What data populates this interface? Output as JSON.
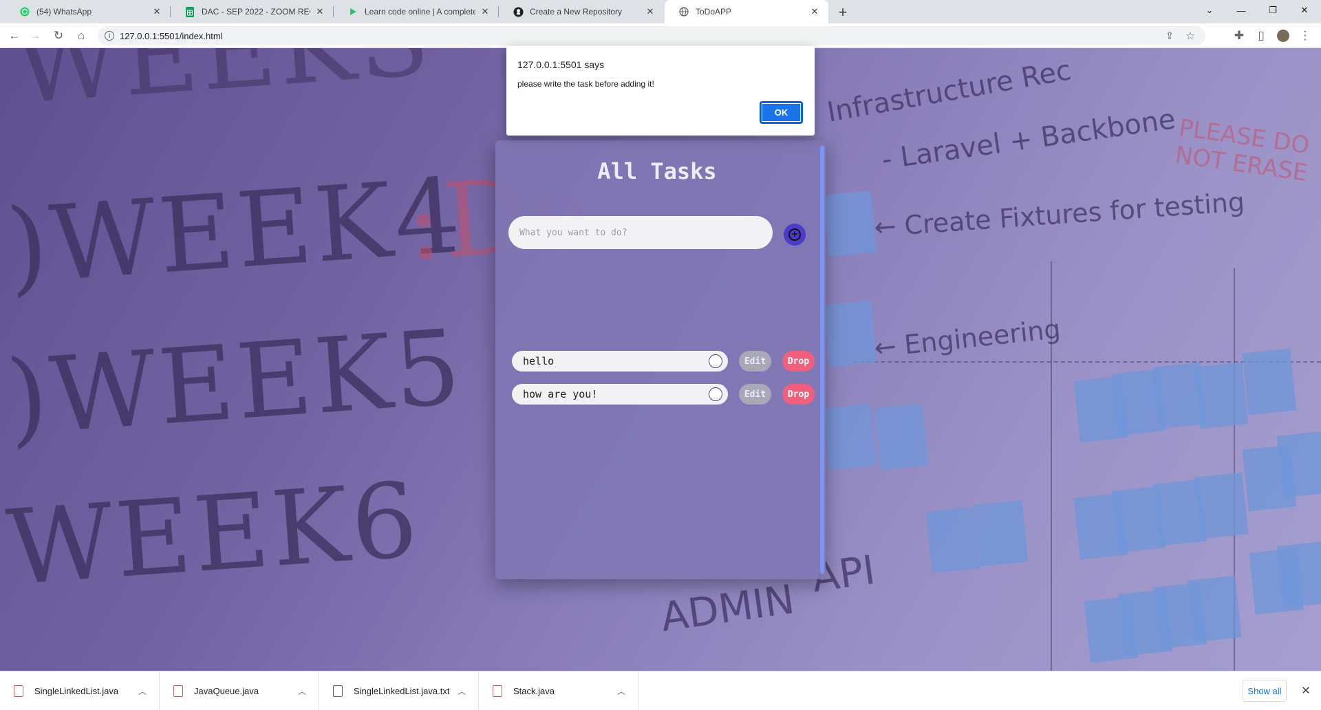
{
  "tabs": [
    {
      "title": "(54) WhatsApp",
      "icon": "whatsapp-icon"
    },
    {
      "title": "DAC - SEP 2022 - ZOOM RECORD",
      "icon": "sheets-icon"
    },
    {
      "title": "Learn code online | A complete p",
      "icon": "play-icon"
    },
    {
      "title": "Create a New Repository",
      "icon": "github-icon"
    },
    {
      "title": "ToDoAPP",
      "icon": "globe-icon",
      "active": true
    }
  ],
  "address_bar": {
    "url": "127.0.0.1:5501/index.html"
  },
  "app": {
    "title": "All Tasks",
    "input_placeholder": "What you want to do?",
    "input_value": "",
    "tasks": [
      {
        "text": "hello",
        "edit_label": "Edit",
        "drop_label": "Drop"
      },
      {
        "text": "how are you!",
        "edit_label": "Edit",
        "drop_label": "Drop"
      }
    ]
  },
  "alert": {
    "title": "127.0.0.1:5501 says",
    "message": "please write the task before adding it!",
    "ok_label": "OK"
  },
  "downloads": {
    "items": [
      {
        "name": "SingleLinkedList.java"
      },
      {
        "name": "JavaQueue.java"
      },
      {
        "name": "SingleLinkedList.java.txt"
      },
      {
        "name": "Stack.java"
      }
    ],
    "show_all_label": "Show all"
  },
  "colors": {
    "accent": "#1a73e8",
    "card_bg": "#8076b4",
    "drop_btn": "#f0607e",
    "edit_btn": "#a8a8b8",
    "add_btn": "#4b3cc9"
  }
}
